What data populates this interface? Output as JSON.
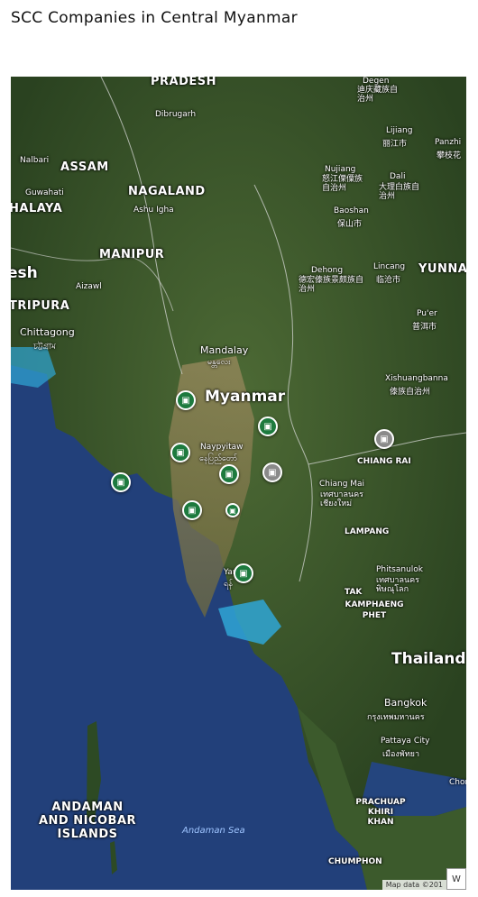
{
  "title": "SCC Companies in Central Myanmar",
  "map": {
    "labels": {
      "pradesh": "PRADESH",
      "dibrugarh": "Dibrugarh",
      "assam": "ASSAM",
      "nalbari": "Nalbari",
      "guwahati": "Guwahati",
      "halaya": "HALAYA",
      "nagaland": "NAGALAND",
      "ashu_igha": "Ashu Igha",
      "manipur": "MANIPUR",
      "desh": "esh",
      "tripura": "TRIPURA",
      "aizawl": "Aizawl",
      "chittagong": "Chittagong",
      "chittagong_local": "চট্টগ্রাম",
      "degen": "Degen",
      "degen_local": "迪庆藏族自治州",
      "lijiang": "Lijiang",
      "lijiang_local": "丽江市",
      "panzhi": "Panzhi",
      "panzhi_local": "攀枝花",
      "nujiang": "Nujiang",
      "nujiang_local": "怒江傈僳族自治州",
      "dali": "Dali",
      "dali_local": "大理白族自治州",
      "baoshan": "Baoshan",
      "baoshan_local": "保山市",
      "dehong": "Dehong",
      "dehong_local": "德宏傣族景颇族自治州",
      "lincang": "Lincang",
      "lincang_local": "临沧市",
      "yunna": "YUNNA",
      "puer": "Pu'er",
      "puer_local": "普洱市",
      "mandalay": "Mandalay",
      "mandalay_local": "မန္တလေး",
      "myanmar": "Myanmar",
      "xishuangbanna": "Xishuangbanna",
      "xishuangbanna_local": "傣族自治州",
      "naypyitaw": "Naypyitaw",
      "naypyitaw_local": "နေပြည်တော်",
      "chiang_rai": "CHIANG RAI",
      "chiang_mai": "Chiang Mai",
      "chiang_mai_local": "เทศบาลนคร เชียงใหม่",
      "lampang": "LAMPANG",
      "yangon": "Yan",
      "yangon_local": "ရန်",
      "phitsanulok": "Phitsanulok",
      "phitsanulok_local": "เทศบาลนคร พิษณุโลก",
      "tak": "TAK",
      "kamphaeng_phet": "KAMPHAENG PHET",
      "thailand": "Thailand",
      "bangkok": "Bangkok",
      "bangkok_local": "กรุงเทพมหานคร",
      "pattaya": "Pattaya City",
      "pattaya_local": "เมืองพัทยา",
      "chon": "Chon",
      "andaman_islands": "ANDAMAN AND NICOBAR ISLANDS",
      "andaman_sea": "Andaman Sea",
      "prachuap": "PRACHUAP KHIRI KHAN",
      "chumphon": "CHUMPHON"
    },
    "attribution": "Map data ©201",
    "corner_text": "W",
    "colors": {
      "land": "#3a5a2a",
      "land_dark": "#23391b",
      "plain": "#8a7a55",
      "sea": "#22407a",
      "shallow": "#2fa6d6",
      "marker_green": "#1d7a3e",
      "marker_gray": "#8a8a8a"
    },
    "markers": [
      {
        "id": "m1",
        "color": "green",
        "icon": "store-icon"
      },
      {
        "id": "m2",
        "color": "green",
        "icon": "store-icon"
      },
      {
        "id": "m3",
        "color": "green",
        "icon": "store-icon"
      },
      {
        "id": "m4",
        "color": "green",
        "icon": "store-icon"
      },
      {
        "id": "m5",
        "color": "green",
        "icon": "store-icon"
      },
      {
        "id": "m6",
        "color": "green",
        "icon": "store-icon"
      },
      {
        "id": "m7",
        "color": "green",
        "icon": "store-icon"
      },
      {
        "id": "m8",
        "color": "green",
        "icon": "store-icon"
      },
      {
        "id": "m9",
        "color": "gray",
        "icon": "store-icon"
      },
      {
        "id": "m10",
        "color": "gray",
        "icon": "store-icon"
      }
    ]
  }
}
